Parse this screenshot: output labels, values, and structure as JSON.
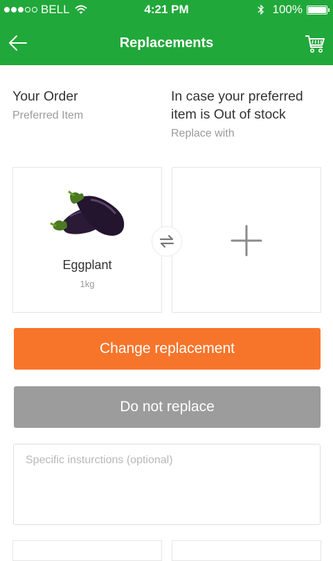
{
  "status_bar": {
    "carrier": "BELL",
    "time": "4:21 PM",
    "battery": "100%"
  },
  "nav": {
    "title": "Replacements",
    "back_icon": "arrow-left-icon",
    "cart_icon": "cart-icon"
  },
  "your_order": {
    "heading": "Your Order",
    "subheading": "Preferred Item"
  },
  "replacement": {
    "heading": "In case your preferred item is Out of stock",
    "subheading": "Replace with"
  },
  "product": {
    "name": "Eggplant",
    "weight": "1kg"
  },
  "buttons": {
    "change": "Change replacement",
    "no_replace": "Do not replace"
  },
  "instructions": {
    "placeholder": "Specific insturctions (optional)",
    "value": ""
  },
  "colors": {
    "brand_green": "#21a83a",
    "accent_orange": "#f7752b",
    "neutral_grey": "#9c9c9c"
  }
}
